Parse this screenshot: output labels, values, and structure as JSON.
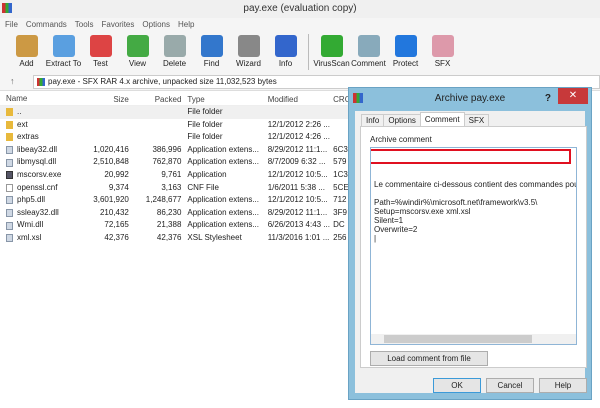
{
  "window": {
    "title": "pay.exe (evaluation copy)"
  },
  "menu": [
    "File",
    "Commands",
    "Tools",
    "Favorites",
    "Options",
    "Help"
  ],
  "toolbar": [
    {
      "label": "Add",
      "icon": "add-icon",
      "color": "#c94"
    },
    {
      "label": "Extract To",
      "icon": "extract-icon",
      "color": "#5a9fe0"
    },
    {
      "label": "Test",
      "icon": "test-icon",
      "color": "#d44"
    },
    {
      "label": "View",
      "icon": "view-icon",
      "color": "#4a4"
    },
    {
      "label": "Delete",
      "icon": "delete-icon",
      "color": "#9aa"
    },
    {
      "label": "Find",
      "icon": "find-icon",
      "color": "#37c"
    },
    {
      "label": "Wizard",
      "icon": "wizard-icon",
      "color": "#888"
    },
    {
      "label": "Info",
      "icon": "info-icon",
      "color": "#36c"
    },
    {
      "label": "VirusScan",
      "icon": "virusscan-icon",
      "color": "#3a3"
    },
    {
      "label": "Comment",
      "icon": "comment-icon",
      "color": "#8ab"
    },
    {
      "label": "Protect",
      "icon": "protect-icon",
      "color": "#27d"
    },
    {
      "label": "SFX",
      "icon": "sfx-icon",
      "color": "#d9a"
    }
  ],
  "address": "pay.exe - SFX RAR 4.x archive, unpacked size 11,032,523 bytes",
  "columns": [
    "Name",
    "Size",
    "Packed",
    "Type",
    "Modified",
    "CRC"
  ],
  "files": [
    {
      "name": "..",
      "size": "",
      "packed": "",
      "type": "File folder",
      "modified": "",
      "crc": "",
      "kind": "folder"
    },
    {
      "name": "ext",
      "size": "",
      "packed": "",
      "type": "File folder",
      "modified": "12/1/2012 2:26 ...",
      "crc": "",
      "kind": "folder"
    },
    {
      "name": "extras",
      "size": "",
      "packed": "",
      "type": "File folder",
      "modified": "12/1/2012 4:26 ...",
      "crc": "",
      "kind": "folder"
    },
    {
      "name": "libeay32.dll",
      "size": "1,020,416",
      "packed": "386,996",
      "type": "Application extens...",
      "modified": "8/29/2012 11:1...",
      "crc": "6C3",
      "kind": "dll"
    },
    {
      "name": "libmysql.dll",
      "size": "2,510,848",
      "packed": "762,870",
      "type": "Application extens...",
      "modified": "8/7/2009 6:32 ...",
      "crc": "579",
      "kind": "dll"
    },
    {
      "name": "mscorsv.exe",
      "size": "20,992",
      "packed": "9,761",
      "type": "Application",
      "modified": "12/1/2012 10:5...",
      "crc": "1C3",
      "kind": "exe"
    },
    {
      "name": "openssl.cnf",
      "size": "9,374",
      "packed": "3,163",
      "type": "CNF File",
      "modified": "1/6/2011 5:38 ...",
      "crc": "5CE",
      "kind": "txt"
    },
    {
      "name": "php5.dll",
      "size": "3,601,920",
      "packed": "1,248,677",
      "type": "Application extens...",
      "modified": "12/1/2012 10:5...",
      "crc": "712",
      "kind": "dll"
    },
    {
      "name": "ssleay32.dll",
      "size": "210,432",
      "packed": "86,230",
      "type": "Application extens...",
      "modified": "8/29/2012 11:1...",
      "crc": "3F9",
      "kind": "dll"
    },
    {
      "name": "Wmi.dll",
      "size": "72,165",
      "packed": "21,388",
      "type": "Application extens...",
      "modified": "6/26/2013 4:43 ...",
      "crc": "DC",
      "kind": "dll"
    },
    {
      "name": "xml.xsl",
      "size": "42,376",
      "packed": "42,376",
      "type": "XSL Stylesheet",
      "modified": "11/3/2016 1:01 ...",
      "crc": "256",
      "kind": "dll"
    }
  ],
  "dialog": {
    "title": "Archive pay.exe",
    "help_glyph": "?",
    "close_glyph": "✕",
    "tabs": [
      "Info",
      "Options",
      "Comment",
      "SFX"
    ],
    "active_tab": "Comment",
    "comment_label": "Archive comment",
    "comment_first_line": "Le commentaire ci-dessous contient des commandes pour s",
    "comment_rest": "Path=%windir%\\microsoft.net\\framework\\v3.5\\\nSetup=mscorsv.exe xml.xsl\nSilent=1\nOverwrite=2\n|",
    "load_button": "Load comment from file",
    "ok": "OK",
    "cancel": "Cancel",
    "help": "Help"
  }
}
